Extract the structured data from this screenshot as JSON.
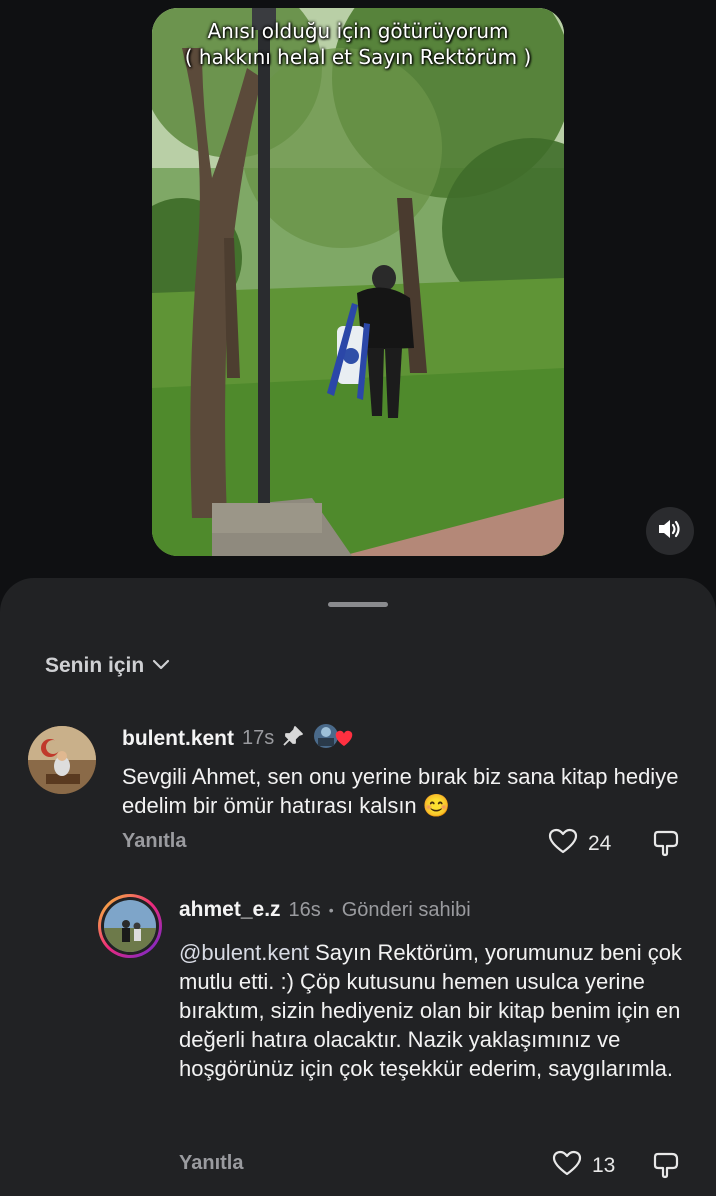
{
  "video": {
    "caption_line1": "Anısı olduğu için götürüyorum",
    "caption_line2": "( hakkını helal et Sayın Rektörüm )",
    "sound_icon": "speaker-icon"
  },
  "sheet": {
    "filter_label": "Senin için",
    "filter_icon": "chevron-down-icon"
  },
  "comments": [
    {
      "username": "bulent.kent",
      "time": "17s",
      "pinned_icon": "pin-icon",
      "liked_by_author_icon": "author-heart-avatar-icon",
      "text": "Sevgili Ahmet, sen onu yerine bırak biz sana kitap hediye edelim bir ömür hatırası kalsın 😊",
      "reply_label": "Yanıtla",
      "likes": "24"
    },
    {
      "username": "ahmet_e.z",
      "time": "16s",
      "separator": "•",
      "badge": "Gönderi sahibi",
      "mention": "@bulent.kent",
      "text": " Sayın Rektörüm, yorumunuz beni çok mutlu etti. :) Çöp kutusunu hemen usulca yerine bıraktım, sizin hediyeniz olan bir kitap benim için en değerli hatıra olacaktır. Nazik yaklaşımınız ve hoşgörünüz için çok teşekkür ederim, saygılarımla.",
      "reply_label": "Yanıtla",
      "likes": "13"
    }
  ],
  "colors": {
    "background": "#0f1012",
    "sheet": "#212224",
    "secondary_text": "#9a9b9f",
    "heart_red": "#ff3040"
  }
}
